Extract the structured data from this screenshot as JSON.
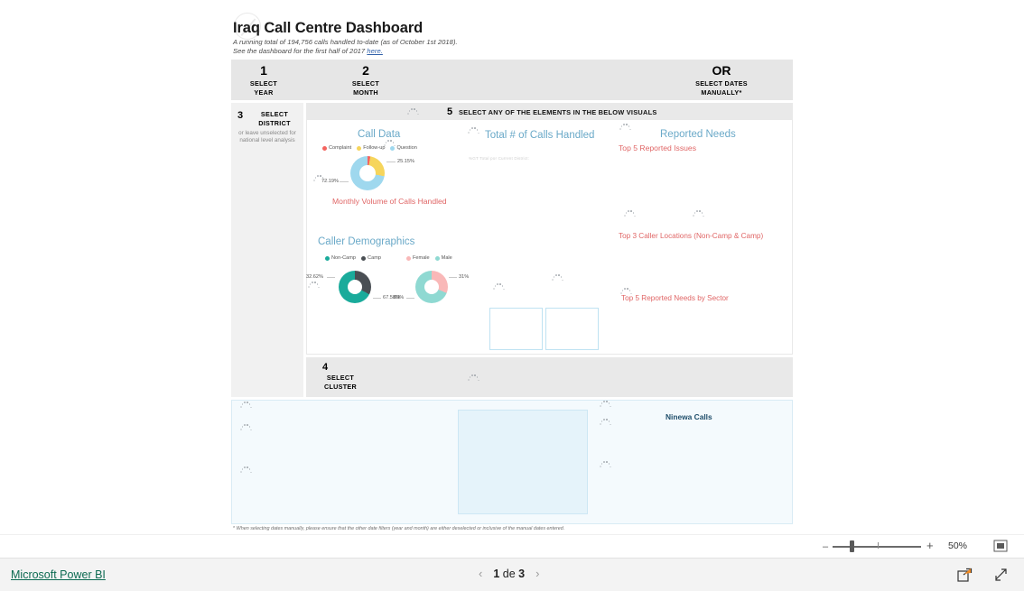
{
  "report": {
    "title": "Iraq Call Centre Dashboard",
    "subtitle_line1": "A running total of 194,756 calls handled to-date (as of October 1st 2018).",
    "subtitle_line2_pre": "See the dashboard for the first half of 2017 ",
    "subtitle_link": "here.",
    "footnote_star": "*",
    "footnote": "When selecting dates manually, please ensure that the other date filters (year and month) are either deselected or inclusive of the manual dates entered."
  },
  "steps": {
    "year": {
      "num": "1",
      "line1": "SELECT",
      "line2": "YEAR"
    },
    "month": {
      "num": "2",
      "line1": "SELECT",
      "line2": "MONTH"
    },
    "dates": {
      "num": "OR",
      "line1": "SELECT DATES",
      "line2": "MANUALLY*"
    }
  },
  "district": {
    "num": "3",
    "label_line1": "SELECT",
    "label_line2": "DISTRICT",
    "hint": "or leave unselected for national level analysis"
  },
  "cluster": {
    "num": "4",
    "label_line1": "SELECT",
    "label_line2": "CLUSTER"
  },
  "visuals_banner": {
    "num": "5",
    "text": "SELECT ANY OF THE ELEMENTS IN THE BELOW VISUALS"
  },
  "visuals": {
    "call_data_title": "Call Data",
    "monthly_volume_title": "Monthly Volume of Calls Handled",
    "caller_demographics_title": "Caller Demographics",
    "total_calls_title": "Total # of Calls Handled",
    "total_calls_note": "%GT Total por Current District:",
    "reported_needs_title": "Reported Needs",
    "top5_issues_title": "Top 5 Reported Issues",
    "top3_locations_title": "Top 3 Caller Locations (Non-Camp & Camp)",
    "top5_sector_title": "Top 5 Reported Needs by Sector"
  },
  "chart_data": [
    {
      "type": "pie",
      "title": "Call Data",
      "legend_position": "top",
      "categories": [
        "Complaint",
        "Follow-up",
        "Question"
      ],
      "values": [
        2.66,
        25.15,
        72.19
      ],
      "labels": [
        "",
        "25.15%",
        "72.19%"
      ],
      "colors": [
        "#f4645f",
        "#f6d55c",
        "#9fd8ee"
      ]
    },
    {
      "type": "pie",
      "title": "Caller Demographics - Camp Status",
      "legend_position": "top",
      "categories": [
        "Non-Camp",
        "Camp"
      ],
      "values": [
        67.58,
        32.62
      ],
      "labels": [
        "67.58%",
        "32.62%"
      ],
      "colors": [
        "#1aab9b",
        "#4a4f54"
      ]
    },
    {
      "type": "pie",
      "title": "Caller Demographics - Gender",
      "legend_position": "top",
      "categories": [
        "Female",
        "Male"
      ],
      "values": [
        31,
        69
      ],
      "labels": [
        "31%",
        "69%"
      ],
      "colors": [
        "#f9b8b8",
        "#8fd9d2"
      ]
    }
  ],
  "map": {
    "title": "Ninewa Calls"
  },
  "zoombar": {
    "minus": "–",
    "plus": "+",
    "percent": "50%"
  },
  "footer": {
    "logo": "Microsoft Power BI",
    "prev": "‹",
    "next": "›",
    "page_current": "1",
    "page_of": " de ",
    "page_total": "3"
  }
}
